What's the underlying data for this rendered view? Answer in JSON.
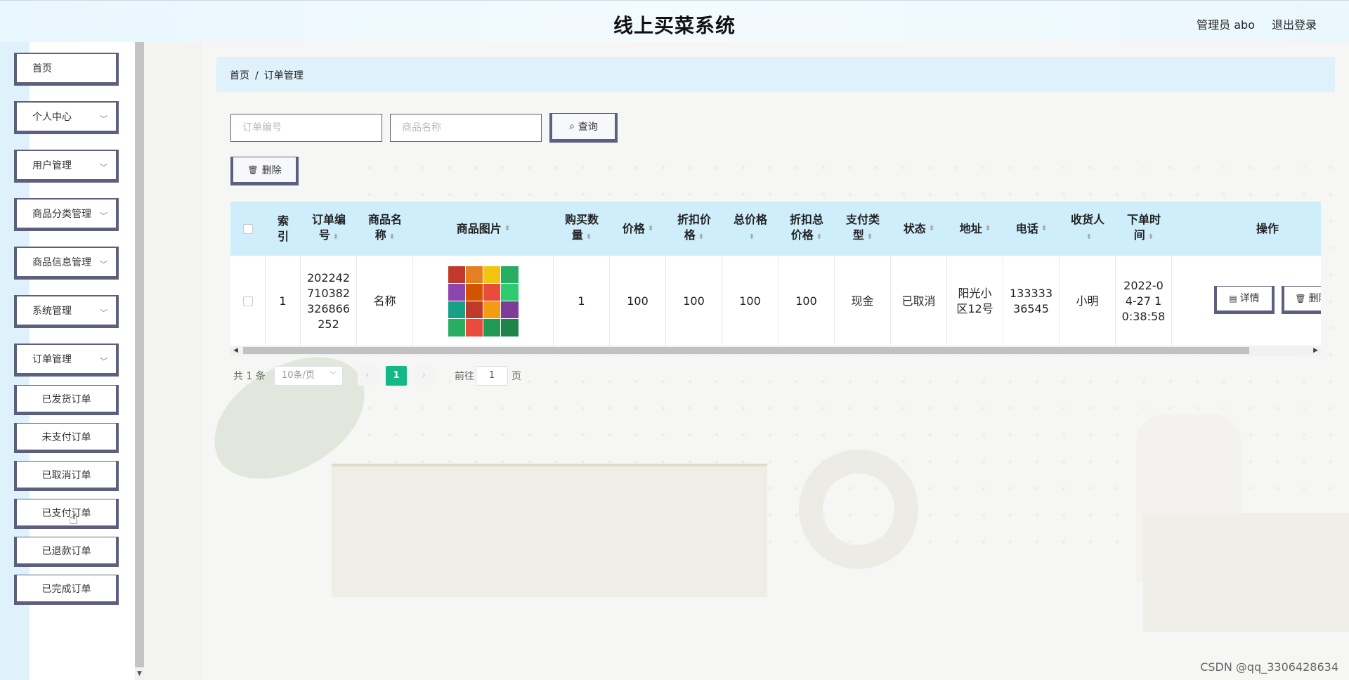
{
  "header": {
    "title": "线上买菜系统",
    "user": "管理员 abo",
    "logout": "退出登录"
  },
  "sidebar": {
    "items": [
      {
        "label": "首页",
        "has_chevron": false
      },
      {
        "label": "个人中心",
        "has_chevron": true
      },
      {
        "label": "用户管理",
        "has_chevron": true
      },
      {
        "label": "商品分类管理",
        "has_chevron": true
      },
      {
        "label": "商品信息管理",
        "has_chevron": true
      },
      {
        "label": "系统管理",
        "has_chevron": true
      },
      {
        "label": "订单管理",
        "has_chevron": true
      }
    ],
    "subitems": [
      "已发货订单",
      "未支付订单",
      "已取消订单",
      "已支付订单",
      "已退款订单",
      "已完成订单"
    ]
  },
  "breadcrumb": {
    "home": "首页",
    "separator": "/",
    "current": "订单管理"
  },
  "search": {
    "order_no_placeholder": "订单编号",
    "product_name_placeholder": "商品名称",
    "query_label": "查询",
    "delete_label": "删除"
  },
  "table": {
    "headers": [
      "索引",
      "订单编号",
      "商品名称",
      "商品图片",
      "购买数量",
      "价格",
      "折扣价格",
      "总价格",
      "折扣总价格",
      "支付类型",
      "状态",
      "地址",
      "电话",
      "收货人",
      "下单时间",
      "操作"
    ],
    "header_lines": {
      "index": [
        "索",
        "引"
      ],
      "order_no": [
        "订单编",
        "号"
      ],
      "product_name": [
        "商品名",
        "称"
      ],
      "product_image": [
        "商品图片"
      ],
      "quantity": [
        "购买数",
        "量"
      ],
      "price": [
        "价格"
      ],
      "discount_price": [
        "折扣价",
        "格"
      ],
      "total_price": [
        "总价格"
      ],
      "discount_total": [
        "折扣总",
        "价格"
      ],
      "pay_type": [
        "支付类",
        "型"
      ],
      "status": [
        "状态"
      ],
      "address": [
        "地址"
      ],
      "phone": [
        "电话"
      ],
      "receiver": [
        "收货人"
      ],
      "order_time": [
        "下单时",
        "间"
      ],
      "actions": [
        "操作"
      ]
    },
    "row": {
      "index": "1",
      "order_no_lines": [
        "202242",
        "710382",
        "326866",
        "252"
      ],
      "product_name": "名称",
      "quantity": "1",
      "price": "100",
      "discount_price": "100",
      "total_price": "100",
      "discount_total": "100",
      "pay_type": "现金",
      "status": "已取消",
      "address_lines": [
        "阳光小",
        "区12号"
      ],
      "phone_lines": [
        "133333",
        "36545"
      ],
      "receiver": "小明",
      "order_time_lines": [
        "2022-0",
        "4-27 1",
        "0:38:58"
      ],
      "detail_label": "详情",
      "delete_label": "删除"
    }
  },
  "pagination": {
    "total": "共 1 条",
    "page_size": "10条/页",
    "current_page": "1",
    "goto_prefix": "前往",
    "goto_value": "1",
    "goto_suffix": "页"
  },
  "watermark": "CSDN @qq_3306428634",
  "colors": {
    "accent_green": "#12b886",
    "header_bg": "#cfeefc",
    "border_dark": "#5d5f7e"
  }
}
